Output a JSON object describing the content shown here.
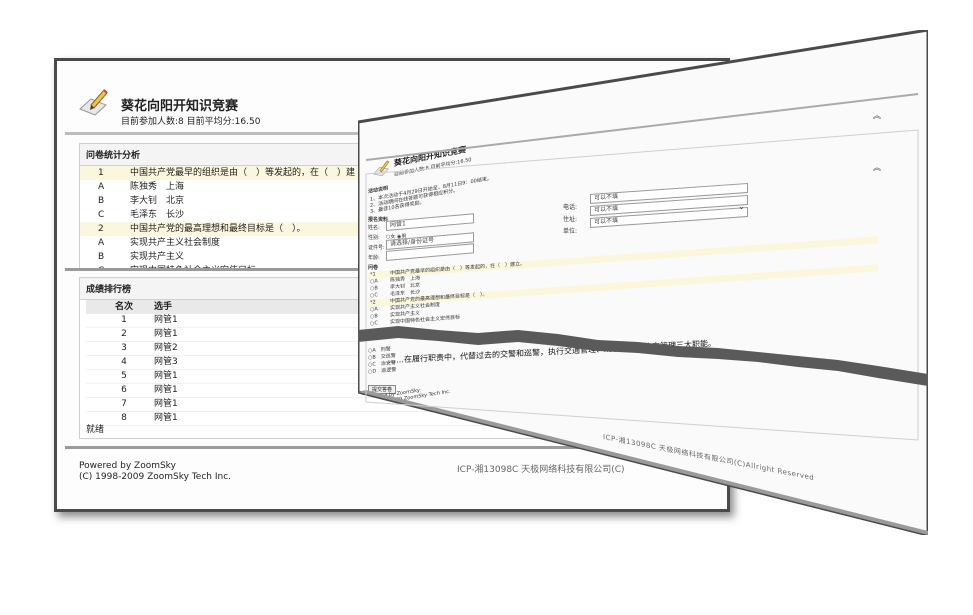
{
  "back": {
    "site_title": "葵花向阳开知识竞赛",
    "site_sub": "目前参加人数:8 目前平均分:16.50",
    "stats": {
      "title": "问卷统计分析",
      "rows": [
        {
          "k": "1",
          "t": "中国共产党最早的组织是由（　）等发起的，在（　）建",
          "q": true
        },
        {
          "k": "A",
          "t": "陈独秀　上海",
          "q": false
        },
        {
          "k": "B",
          "t": "李大钊　北京",
          "q": false
        },
        {
          "k": "C",
          "t": "毛泽东　长沙",
          "q": false
        },
        {
          "k": "2",
          "t": "中国共产党的最高理想和最终目标是（　）。",
          "q": true
        },
        {
          "k": "A",
          "t": "实现共产主义社会制度",
          "q": false
        },
        {
          "k": "B",
          "t": "实现共产主义",
          "q": false
        },
        {
          "k": "C",
          "t": "实现中国特色社会主义宏伟目标",
          "q": false
        }
      ]
    },
    "rank": {
      "title": "成绩排行榜",
      "col_rank": "名次",
      "col_player": "选手",
      "rows": [
        {
          "r": "1",
          "p": "网管1"
        },
        {
          "r": "2",
          "p": "网管1"
        },
        {
          "r": "3",
          "p": "网管2"
        },
        {
          "r": "4",
          "p": "网管3"
        },
        {
          "r": "5",
          "p": "网管1"
        },
        {
          "r": "6",
          "p": "网管1"
        },
        {
          "r": "7",
          "p": "网管1"
        },
        {
          "r": "8",
          "p": "网管1"
        }
      ],
      "status": "就绪"
    },
    "footer_line1": "Powered by ZoomSky",
    "footer_line2": "(C) 1998-2009 ZoomSky Tech Inc.",
    "footer_right": "ICP-湘13098C 天极网络科技有限公司(C)"
  },
  "front": {
    "site_title": "葵花向阳开知识竞赛",
    "site_sub": "目前参加人数:8 目前平均分:16.50",
    "instructions_title": "活动说明",
    "instructions": [
      "1、本次活动于4月29日开始至，8月11日9：00结束。",
      "2、活动期间在线答题可获得相应积分。",
      "3、最佳10名获得奖励。"
    ],
    "reg_title": "报名资料",
    "name_label": "姓名:",
    "name_value": "网管1",
    "gender_label": "性别:",
    "gender_options": "○女 ◉男",
    "id_label": "证件号:",
    "id_value": "请选择/身份证号",
    "age_label": "年龄:",
    "phone_label": "电话:",
    "phone_value": "可以不填",
    "address_label": "住址:",
    "address_value": "可以不填",
    "unit_label": "单位:",
    "unit_value": "可以不填",
    "questions_title": "问卷",
    "q_rows": [
      {
        "k": "*1",
        "t": "中国共产党最早的组织是由（　）等发起的，在（　）建立。",
        "q": true
      },
      {
        "k": "○A",
        "t": "陈独秀　上海",
        "q": false
      },
      {
        "k": "○B",
        "t": "李大钊　北京",
        "q": false
      },
      {
        "k": "○C",
        "t": "毛泽东　长沙",
        "q": false
      },
      {
        "k": "*2",
        "t": "中国共产党的最高理想和最终目标是（　）。",
        "q": true
      },
      {
        "k": "○A",
        "t": "实现共产主义社会制度",
        "q": false
      },
      {
        "k": "○B",
        "t": "实现共产主义",
        "q": false
      },
      {
        "k": "○C",
        "t": "实现中国特色社会主义宏伟目标",
        "q": false
      }
    ],
    "big_question": "……在履行职责中，代替过去的交警和巡警，执行交通管理、刑事执法、治安管理三大职能。",
    "lower_rows": [
      "○A　刑警",
      "○B　交巡警",
      "○C　治安警",
      "○D　巡逻警"
    ],
    "submit_label": "提交答卷",
    "footer_line1": "Powered by ZoomSky",
    "footer_line2": "(C) 1998-2009 ZoomSky Tech Inc.",
    "footer_right": "ICP-湘13098C 天极网络科技有限公司(C)Allright Reserved"
  }
}
